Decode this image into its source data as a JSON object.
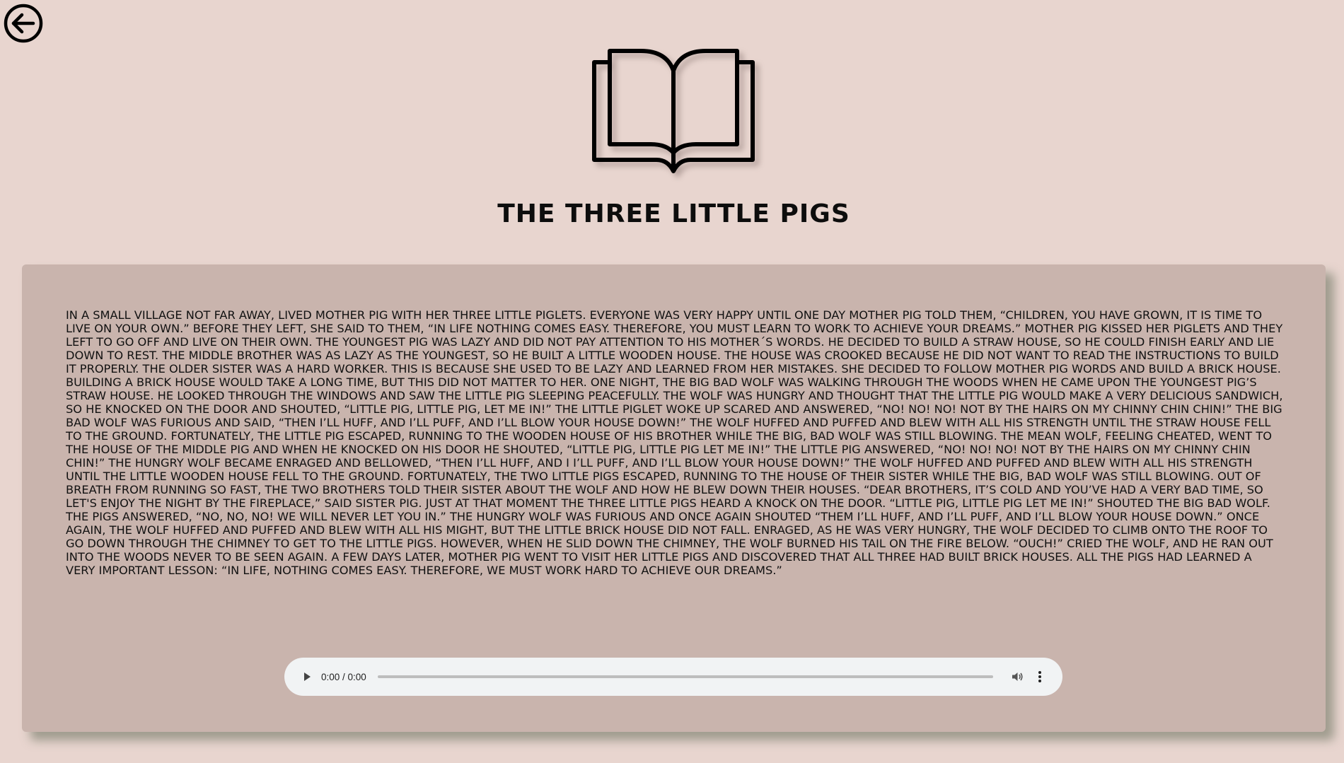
{
  "nav": {
    "back_icon": "arrow-left-circle-icon"
  },
  "header": {
    "icon": "open-book-icon",
    "title": "THE THREE LITTLE PIGS"
  },
  "story": {
    "text": "IN A SMALL VILLAGE NOT FAR AWAY, LIVED MOTHER PIG WITH HER THREE LITTLE PIGLETS. EVERYONE WAS VERY HAPPY UNTIL ONE DAY MOTHER PIG TOLD THEM, “CHILDREN, YOU HAVE GROWN, IT IS TIME TO LIVE ON YOUR OWN.” BEFORE THEY LEFT, SHE SAID TO THEM, “IN LIFE NOTHING COMES EASY. THEREFORE, YOU MUST LEARN TO WORK TO ACHIEVE YOUR DREAMS.” MOTHER PIG KISSED HER PIGLETS AND THEY LEFT TO GO OFF AND LIVE ON THEIR OWN. THE YOUNGEST PIG WAS LAZY AND DID NOT PAY ATTENTION TO HIS MOTHER´S WORDS. HE DECIDED TO BUILD A STRAW HOUSE, SO HE COULD FINISH EARLY AND LIE DOWN TO REST. THE MIDDLE BROTHER WAS AS LAZY AS THE YOUNGEST, SO HE BUILT A LITTLE WOODEN HOUSE. THE HOUSE WAS CROOKED BECAUSE HE DID NOT WANT TO READ THE INSTRUCTIONS TO BUILD IT PROPERLY. THE OLDER SISTER WAS A HARD WORKER. THIS IS BECAUSE SHE USED TO BE LAZY AND LEARNED FROM HER MISTAKES. SHE DECIDED TO FOLLOW MOTHER PIG WORDS AND BUILD A BRICK HOUSE. BUILDING A BRICK HOUSE WOULD TAKE A LONG TIME, BUT THIS DID NOT MATTER TO HER. ONE NIGHT, THE BIG BAD WOLF WAS WALKING THROUGH THE WOODS WHEN HE CAME UPON THE YOUNGEST PIG’S STRAW HOUSE. HE LOOKED THROUGH THE WINDOWS AND SAW THE LITTLE PIG SLEEPING PEACEFULLY. THE WOLF WAS HUNGRY AND THOUGHT THAT THE LITTLE PIG WOULD MAKE A VERY DELICIOUS SANDWICH, SO HE KNOCKED ON THE DOOR AND SHOUTED, “LITTLE PIG, LITTLE PIG, LET ME IN!” THE LITTLE PIGLET WOKE UP SCARED AND ANSWERED, “NO! NO! NO! NOT BY THE HAIRS ON MY CHINNY CHIN CHIN!” THE BIG BAD WOLF WAS FURIOUS AND SAID, “THEN I’LL HUFF, AND I’LL PUFF, AND I’LL BLOW YOUR HOUSE DOWN!” THE WOLF HUFFED AND PUFFED AND BLEW WITH ALL HIS STRENGTH UNTIL THE STRAW HOUSE FELL TO THE GROUND. FORTUNATELY, THE LITTLE PIG ESCAPED, RUNNING TO THE WOODEN HOUSE OF HIS BROTHER WHILE THE BIG, BAD WOLF WAS STILL BLOWING. THE MEAN WOLF, FEELING CHEATED, WENT TO THE HOUSE OF THE MIDDLE PIG AND WHEN HE KNOCKED ON HIS DOOR HE SHOUTED, “LITTLE PIG, LITTLE PIG LET ME IN!” THE LITTLE PIG ANSWERED, “NO! NO! NO! NOT BY THE HAIRS ON MY CHINNY CHIN CHIN!” THE HUNGRY WOLF BECAME ENRAGED AND BELLOWED, “THEN I’LL HUFF, AND I I’LL PUFF, AND I’LL BLOW YOUR HOUSE DOWN!” THE WOLF HUFFED AND PUFFED AND BLEW WITH ALL HIS STRENGTH UNTIL THE LITTLE WOODEN HOUSE FELL TO THE GROUND. FORTUNATELY, THE TWO LITTLE PIGS ESCAPED, RUNNING TO THE HOUSE OF THEIR SISTER WHILE THE BIG, BAD WOLF WAS STILL BLOWING. OUT OF BREATH FROM RUNNING SO FAST, THE TWO BROTHERS TOLD THEIR SISTER ABOUT THE WOLF AND HOW HE BLEW DOWN THEIR HOUSES. “DEAR BROTHERS, IT’S COLD AND YOU’VE HAD A VERY BAD TIME, SO LET'S ENJOY THE NIGHT BY THE FIREPLACE,” SAID SISTER PIG. JUST AT THAT MOMENT THE THREE LITTLE PIGS HEARD A KNOCK ON THE DOOR. “LITTLE PIG, LITTLE PIG LET ME IN!” SHOUTED THE BIG BAD WOLF. THE PIGS ANSWERED, “NO, NO, NO! WE WILL NEVER LET YOU IN.” THE HUNGRY WOLF WAS FURIOUS AND ONCE AGAIN SHOUTED “THEM I’LL HUFF, AND I’LL PUFF, AND I’LL BLOW YOUR HOUSE DOWN.” ONCE AGAIN, THE WOLF HUFFED AND PUFFED AND BLEW WITH ALL HIS MIGHT, BUT THE LITTLE BRICK HOUSE DID NOT FALL. ENRAGED, AS HE WAS VERY HUNGRY, THE WOLF DECIDED TO CLIMB ONTO THE ROOF TO GO DOWN THROUGH THE CHIMNEY TO GET TO THE LITTLE PIGS. HOWEVER, WHEN HE SLID DOWN THE CHIMNEY, THE WOLF BURNED HIS TAIL ON THE FIRE BELOW. “OUCH!” CRIED THE WOLF, AND HE RAN OUT INTO THE WOODS NEVER TO BE SEEN AGAIN. A FEW DAYS LATER, MOTHER PIG WENT TO VISIT HER LITTLE PIGS AND DISCOVERED THAT ALL THREE HAD BUILT BRICK HOUSES. ALL THE PIGS HAD LEARNED A VERY IMPORTANT LESSON: “IN LIFE, NOTHING COMES EASY. THEREFORE, WE MUST WORK HARD TO ACHIEVE OUR DREAMS.”"
  },
  "audio": {
    "play_icon": "play-icon",
    "time": "0:00 / 0:00",
    "progress": 0,
    "volume_icon": "volume-icon",
    "menu_icon": "more-vertical-icon"
  },
  "colors": {
    "page_background": "#e8d5cf",
    "card_background": "#c9b4ad",
    "player_background": "#f1f3f4",
    "text": "#111111"
  }
}
